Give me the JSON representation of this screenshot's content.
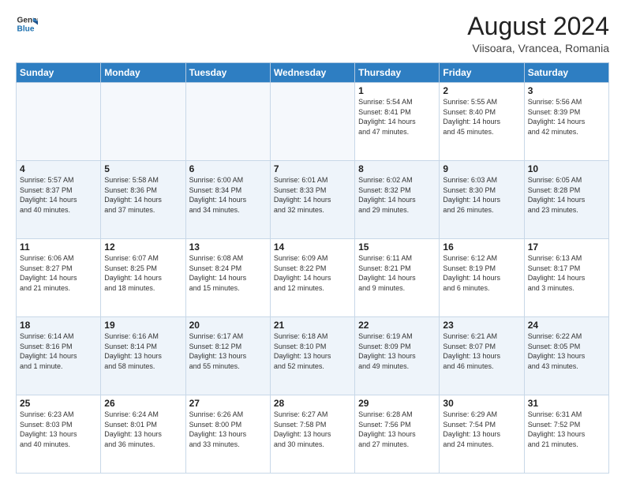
{
  "header": {
    "logo_line1": "General",
    "logo_line2": "Blue",
    "month": "August 2024",
    "location": "Viisoara, Vrancea, Romania"
  },
  "weekdays": [
    "Sunday",
    "Monday",
    "Tuesday",
    "Wednesday",
    "Thursday",
    "Friday",
    "Saturday"
  ],
  "weeks": [
    [
      {
        "day": "",
        "info": ""
      },
      {
        "day": "",
        "info": ""
      },
      {
        "day": "",
        "info": ""
      },
      {
        "day": "",
        "info": ""
      },
      {
        "day": "1",
        "info": "Sunrise: 5:54 AM\nSunset: 8:41 PM\nDaylight: 14 hours\nand 47 minutes."
      },
      {
        "day": "2",
        "info": "Sunrise: 5:55 AM\nSunset: 8:40 PM\nDaylight: 14 hours\nand 45 minutes."
      },
      {
        "day": "3",
        "info": "Sunrise: 5:56 AM\nSunset: 8:39 PM\nDaylight: 14 hours\nand 42 minutes."
      }
    ],
    [
      {
        "day": "4",
        "info": "Sunrise: 5:57 AM\nSunset: 8:37 PM\nDaylight: 14 hours\nand 40 minutes."
      },
      {
        "day": "5",
        "info": "Sunrise: 5:58 AM\nSunset: 8:36 PM\nDaylight: 14 hours\nand 37 minutes."
      },
      {
        "day": "6",
        "info": "Sunrise: 6:00 AM\nSunset: 8:34 PM\nDaylight: 14 hours\nand 34 minutes."
      },
      {
        "day": "7",
        "info": "Sunrise: 6:01 AM\nSunset: 8:33 PM\nDaylight: 14 hours\nand 32 minutes."
      },
      {
        "day": "8",
        "info": "Sunrise: 6:02 AM\nSunset: 8:32 PM\nDaylight: 14 hours\nand 29 minutes."
      },
      {
        "day": "9",
        "info": "Sunrise: 6:03 AM\nSunset: 8:30 PM\nDaylight: 14 hours\nand 26 minutes."
      },
      {
        "day": "10",
        "info": "Sunrise: 6:05 AM\nSunset: 8:28 PM\nDaylight: 14 hours\nand 23 minutes."
      }
    ],
    [
      {
        "day": "11",
        "info": "Sunrise: 6:06 AM\nSunset: 8:27 PM\nDaylight: 14 hours\nand 21 minutes."
      },
      {
        "day": "12",
        "info": "Sunrise: 6:07 AM\nSunset: 8:25 PM\nDaylight: 14 hours\nand 18 minutes."
      },
      {
        "day": "13",
        "info": "Sunrise: 6:08 AM\nSunset: 8:24 PM\nDaylight: 14 hours\nand 15 minutes."
      },
      {
        "day": "14",
        "info": "Sunrise: 6:09 AM\nSunset: 8:22 PM\nDaylight: 14 hours\nand 12 minutes."
      },
      {
        "day": "15",
        "info": "Sunrise: 6:11 AM\nSunset: 8:21 PM\nDaylight: 14 hours\nand 9 minutes."
      },
      {
        "day": "16",
        "info": "Sunrise: 6:12 AM\nSunset: 8:19 PM\nDaylight: 14 hours\nand 6 minutes."
      },
      {
        "day": "17",
        "info": "Sunrise: 6:13 AM\nSunset: 8:17 PM\nDaylight: 14 hours\nand 3 minutes."
      }
    ],
    [
      {
        "day": "18",
        "info": "Sunrise: 6:14 AM\nSunset: 8:16 PM\nDaylight: 14 hours\nand 1 minute."
      },
      {
        "day": "19",
        "info": "Sunrise: 6:16 AM\nSunset: 8:14 PM\nDaylight: 13 hours\nand 58 minutes."
      },
      {
        "day": "20",
        "info": "Sunrise: 6:17 AM\nSunset: 8:12 PM\nDaylight: 13 hours\nand 55 minutes."
      },
      {
        "day": "21",
        "info": "Sunrise: 6:18 AM\nSunset: 8:10 PM\nDaylight: 13 hours\nand 52 minutes."
      },
      {
        "day": "22",
        "info": "Sunrise: 6:19 AM\nSunset: 8:09 PM\nDaylight: 13 hours\nand 49 minutes."
      },
      {
        "day": "23",
        "info": "Sunrise: 6:21 AM\nSunset: 8:07 PM\nDaylight: 13 hours\nand 46 minutes."
      },
      {
        "day": "24",
        "info": "Sunrise: 6:22 AM\nSunset: 8:05 PM\nDaylight: 13 hours\nand 43 minutes."
      }
    ],
    [
      {
        "day": "25",
        "info": "Sunrise: 6:23 AM\nSunset: 8:03 PM\nDaylight: 13 hours\nand 40 minutes."
      },
      {
        "day": "26",
        "info": "Sunrise: 6:24 AM\nSunset: 8:01 PM\nDaylight: 13 hours\nand 36 minutes."
      },
      {
        "day": "27",
        "info": "Sunrise: 6:26 AM\nSunset: 8:00 PM\nDaylight: 13 hours\nand 33 minutes."
      },
      {
        "day": "28",
        "info": "Sunrise: 6:27 AM\nSunset: 7:58 PM\nDaylight: 13 hours\nand 30 minutes."
      },
      {
        "day": "29",
        "info": "Sunrise: 6:28 AM\nSunset: 7:56 PM\nDaylight: 13 hours\nand 27 minutes."
      },
      {
        "day": "30",
        "info": "Sunrise: 6:29 AM\nSunset: 7:54 PM\nDaylight: 13 hours\nand 24 minutes."
      },
      {
        "day": "31",
        "info": "Sunrise: 6:31 AM\nSunset: 7:52 PM\nDaylight: 13 hours\nand 21 minutes."
      }
    ]
  ]
}
